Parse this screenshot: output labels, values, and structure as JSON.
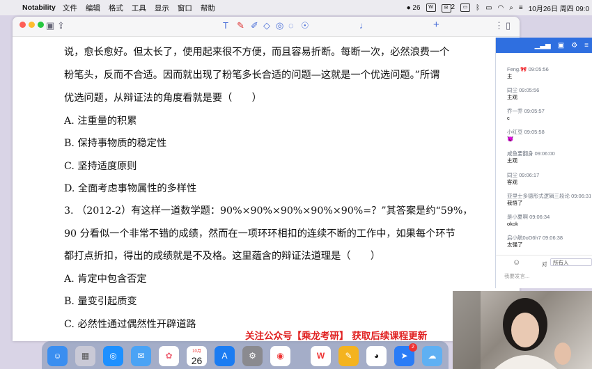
{
  "menubar": {
    "app": "Notability",
    "menus": [
      "文件",
      "编辑",
      "格式",
      "工具",
      "显示",
      "窗口",
      "帮助"
    ],
    "status": {
      "badge_count": "26",
      "wechat_count": "2",
      "datetime": "10月26日 周四 09:0"
    }
  },
  "document": {
    "lines": [
      "说，愈长愈好。但太长了，使用起来很不方便，而且容易折断。每断一次，必然浪费一个",
      "粉笔头，反而不合适。因而就出现了粉笔多长合适的问题—这就是一个优选问题。”所谓",
      "优选问题，从辩证法的角度看就是要（　　）",
      "A. 注重量的积累",
      "B. 保持事物质的稳定性",
      "C. 坚持适度原则",
      "D. 全面考虑事物属性的多样性",
      "3. （2012-2）有这样一道数学题：90%×90%×90%×90%×90%=？”其答案是约“59%，",
      "90 分看似一个非常不错的成绩，然而在一项环环相扣的连续不断的工作中，如果每个环节",
      "都打点折扣，得出的成绩就是不及格。这里蕴含的辩证法道理是（　　）",
      "A. 肯定中包含否定",
      "B. 量变引起质变",
      "C. 必然性通过偶然性开辟道路"
    ]
  },
  "chat": {
    "messages": [
      {
        "who": "Feng.🎀 09:05:56",
        "text": "主"
      },
      {
        "who": "同尘 09:05:56",
        "text": "主观"
      },
      {
        "who": "乔一乔 09:05:57",
        "text": "c"
      },
      {
        "who": "小红豆 09:05:58",
        "text": "😈"
      },
      {
        "who": "咸鱼要翻身 09:06:00",
        "text": "主观"
      },
      {
        "who": "同尘 09:06:17",
        "text": "客观"
      },
      {
        "who": "亚里士多德形式逻辑三段论 09:06:31",
        "text": "我悟了"
      },
      {
        "who": "是小夏啊 09:06:34",
        "text": "okok"
      },
      {
        "who": "启小航0oD6h7 09:06:38",
        "text": "太强了"
      }
    ],
    "to_label": "对",
    "recipient": "所有人",
    "input_placeholder": "我要发言..."
  },
  "banner": "关注公众号【乘龙考研】 获取后续课程更新",
  "dock": {
    "calendar_month": "10月",
    "calendar_day": "26",
    "badge": "2"
  }
}
